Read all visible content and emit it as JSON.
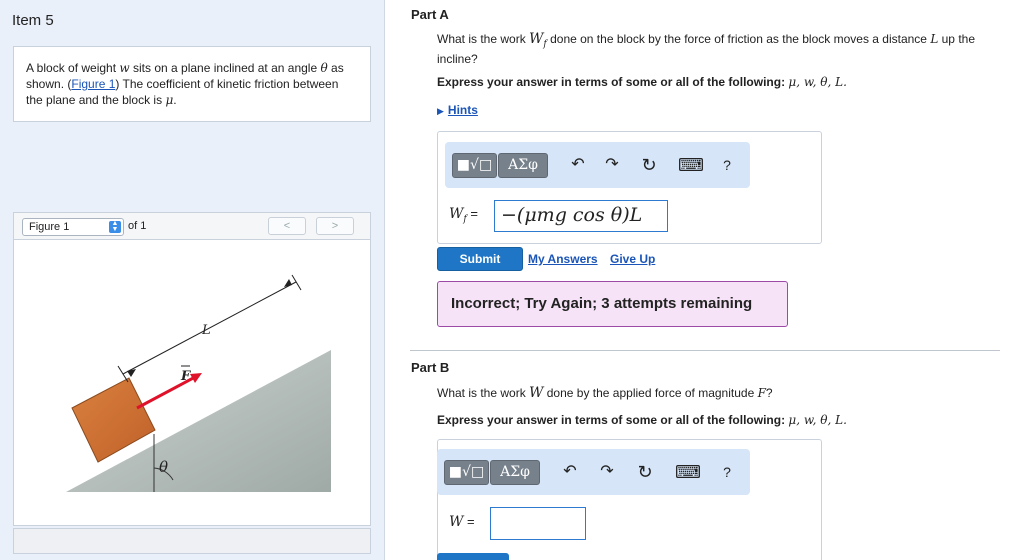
{
  "item": {
    "title": "Item 5"
  },
  "problem": {
    "text_1": "A block of weight ",
    "w": "w",
    "text_2": " sits on a plane inclined at an angle ",
    "theta": "θ",
    "text_3": " as shown. (",
    "figure_link": "Figure 1",
    "text_4": ") The coefficient of kinetic friction between the plane and the block is ",
    "mu": "μ",
    "text_5": "."
  },
  "figure_bar": {
    "selected": "Figure 1",
    "of_label": "of 1",
    "prev": "<",
    "next": ">"
  },
  "figure": {
    "label_L": "L",
    "label_F": "F",
    "label_theta": "θ"
  },
  "partA": {
    "title": "Part A",
    "q1": "What is the work ",
    "q_sym": "W",
    "q_sub": "f",
    "q2": " done on the block by the force of friction as the block moves a distance ",
    "q_L": "L",
    "q3": " up the incline?",
    "express": "Express your answer in terms of some or all of the following: ",
    "express_vars": "μ, w, θ, L.",
    "hints": "Hints",
    "eq_label_sym": "W",
    "eq_label_sub": "f",
    "eq_label_eq": " =",
    "answer": "−(μmg cos θ)L",
    "submit": "Submit",
    "my_answers": "My Answers",
    "give_up": "Give Up",
    "feedback": "Incorrect; Try Again; 3 attempts remaining"
  },
  "partB": {
    "title": "Part B",
    "q1": "What is the work ",
    "q_sym": "W",
    "q2": " done by the applied force of magnitude ",
    "q_F": "F",
    "q3": "?",
    "express": "Express your answer in terms of some or all of the following: ",
    "express_vars": "μ, w, θ, L.",
    "eq_label_sym": "W",
    "eq_label_eq": " =",
    "answer": ""
  },
  "toolbar": {
    "templates": "■√□",
    "greek": "ΑΣφ",
    "undo": "↶",
    "redo": "↷",
    "reset": "↻",
    "keyboard": "⌨",
    "help": "?"
  }
}
